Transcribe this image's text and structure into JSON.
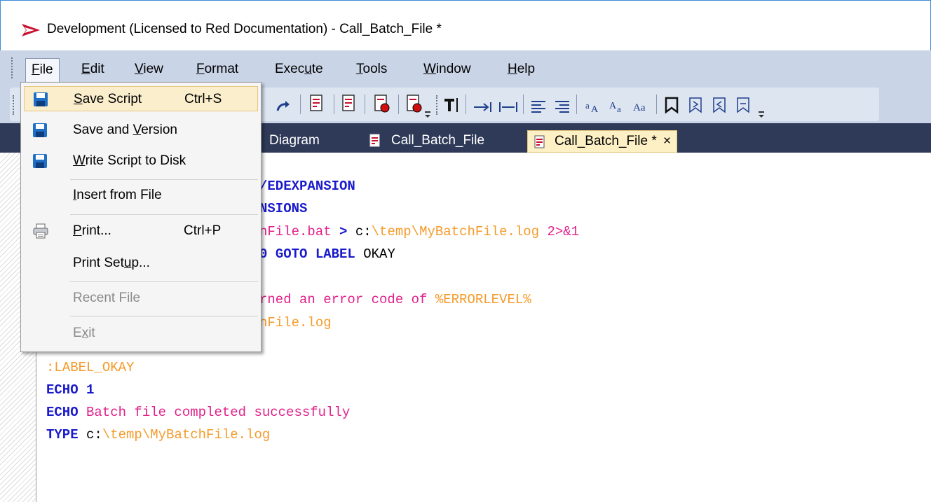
{
  "window": {
    "title": "Development  (Licensed to Red Documentation) - Call_Batch_File *"
  },
  "menubar": [
    {
      "key": "F",
      "rest": "ile"
    },
    {
      "key": "E",
      "rest": "dit"
    },
    {
      "key": "V",
      "rest": "iew"
    },
    {
      "key": "F",
      "rest": "ormat"
    },
    {
      "pre": "Exec",
      "key": "u",
      "rest": "te"
    },
    {
      "key": "T",
      "rest": "ools"
    },
    {
      "key": "W",
      "rest": "indow"
    },
    {
      "key": "H",
      "rest": "elp"
    }
  ],
  "tabs": {
    "diagram": "Diagram",
    "script1": "Call_Batch_File",
    "script2": "Call_Batch_File *",
    "close": "×"
  },
  "file_menu": {
    "save_script": {
      "key": "S",
      "rest": "ave Script",
      "shortcut": "Ctrl+S"
    },
    "save_version": {
      "pre": "Save and ",
      "key": "V",
      "rest": "ersion"
    },
    "write_script": {
      "key": "W",
      "rest": "rite Script to Disk"
    },
    "insert_file": {
      "key": "I",
      "rest": "nsert from File"
    },
    "print": {
      "key": "P",
      "rest": "rint...",
      "shortcut": "Ctrl+P"
    },
    "print_setup": {
      "pre": "Print Set",
      "key": "u",
      "rest": "p..."
    },
    "recent_file": "Recent File",
    "exit": {
      "pre": "E",
      "key": "x",
      "rest": "it"
    }
  },
  "code": {
    "l1": "/EDEXPANSION",
    "l2": "NSIONS",
    "l3_a": "nFile.bat ",
    "l3_b": "> ",
    "l3_c": "c:",
    "l3_d": "\\temp\\MyBatchFile.log ",
    "l3_e": "2>&1",
    "l4_a": "0 ",
    "l4_b": "GOTO LABEL",
    "l4_c": " OKAY",
    "l5": "rned an error code of ",
    "l5_var": "%ERRORLEVEL%",
    "l6": "nFile.log",
    "l7": ":LABEL_OKAY",
    "l8_kw": "ECHO ",
    "l8_num": "1",
    "l9_kw": "ECHO ",
    "l9_txt": "Batch file completed successfully",
    "l10_kw": "TYPE ",
    "l10_drv": "c:",
    "l10_path": "\\temp\\MyBatchFile.log"
  },
  "colors": {
    "accent": "#2e3a58",
    "menubar": "#c9d4e7",
    "highlight": "#fbeecd",
    "keyword": "#1a1acd",
    "text": "#e0208a",
    "path": "#f59b2b"
  }
}
